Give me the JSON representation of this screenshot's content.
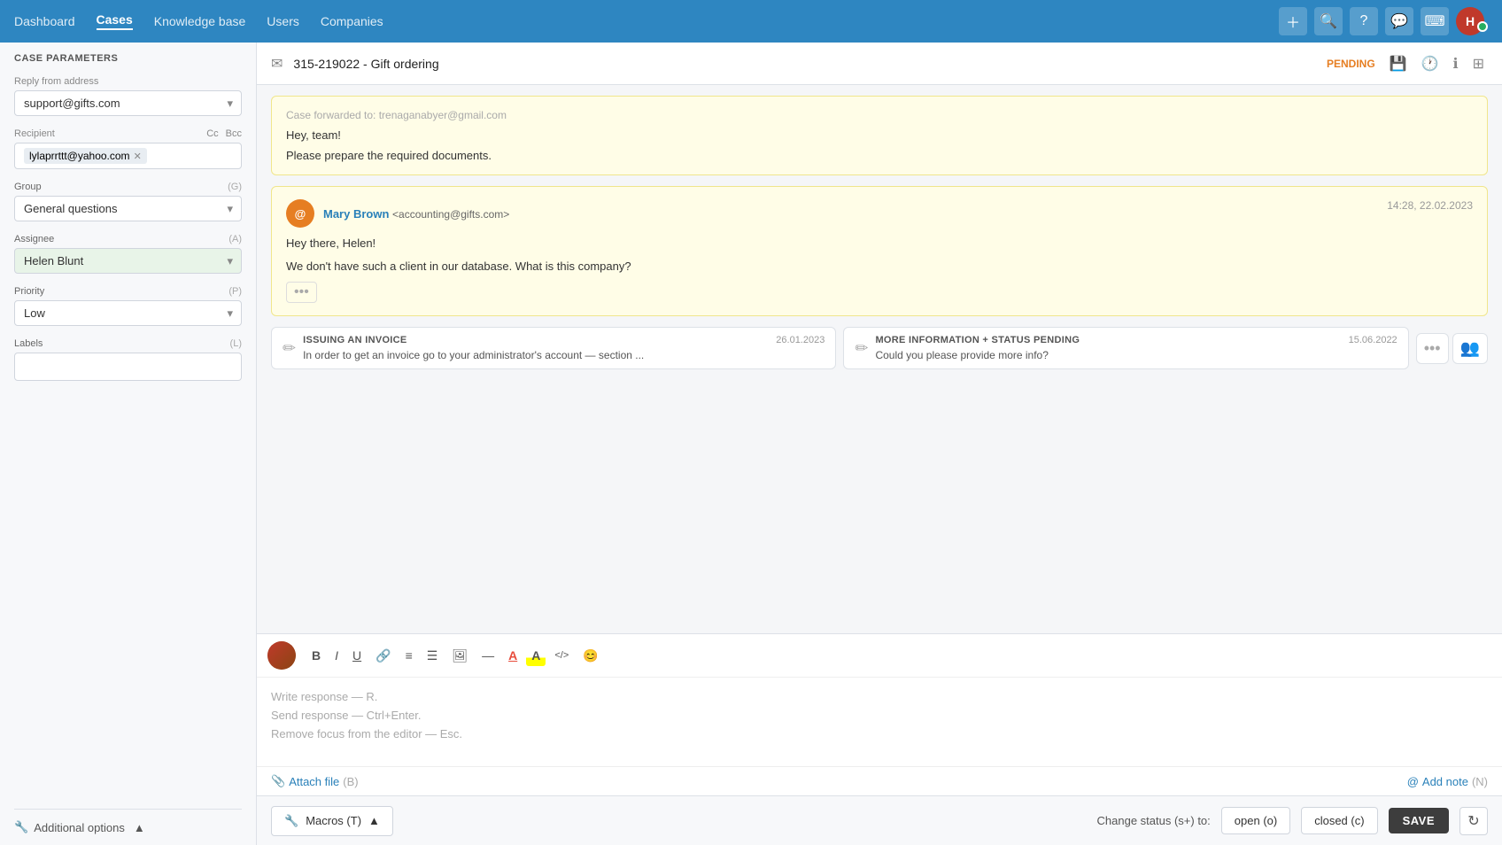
{
  "nav": {
    "items": [
      {
        "label": "Dashboard",
        "active": false
      },
      {
        "label": "Cases",
        "active": true
      },
      {
        "label": "Knowledge base",
        "active": false
      },
      {
        "label": "Users",
        "active": false
      },
      {
        "label": "Companies",
        "active": false
      }
    ],
    "icons": [
      "plus-icon",
      "search-icon",
      "help-icon",
      "chat-icon",
      "keyboard-icon"
    ]
  },
  "sidebar": {
    "title": "CASE PARAMETERS",
    "fields": {
      "reply_from": {
        "label": "Reply from address",
        "value": "support@gifts.com"
      },
      "recipient": {
        "label": "Recipient",
        "cc": "Cc",
        "bcc": "Bcc",
        "value": "lylaprrttt@yahoo.com"
      },
      "group": {
        "label": "Group",
        "shortcut": "(G)",
        "value": "General questions"
      },
      "assignee": {
        "label": "Assignee",
        "shortcut": "(A)",
        "value": "Helen Blunt"
      },
      "priority": {
        "label": "Priority",
        "shortcut": "(P)",
        "value": "Low"
      },
      "labels": {
        "label": "Labels",
        "shortcut": "(L)",
        "value": ""
      }
    },
    "additional_options": "Additional options"
  },
  "case_header": {
    "case_id": "315-219022",
    "subject": "Gift ordering",
    "full_title": "315-219022 - Gift ordering",
    "status": "PENDING"
  },
  "messages": [
    {
      "id": "msg1",
      "partial": true,
      "body_lines": [
        "Hey, team!",
        "Please prepare the required documents."
      ]
    },
    {
      "id": "msg2",
      "sender_name": "Mary Brown",
      "sender_email": "<accounting@gifts.com>",
      "time": "14:28, 22.02.2023",
      "avatar_text": "@",
      "body_lines": [
        "Hey there, Helen!",
        "We don't have such a client in our database. What is this company?"
      ]
    }
  ],
  "canned_responses": [
    {
      "title": "ISSUING AN INVOICE",
      "date": "26.01.2023",
      "body": "In order to get an invoice  go to your administrator's account — section ..."
    },
    {
      "title": "MORE INFORMATION + STATUS PENDING",
      "date": "15.06.2022",
      "body": "Could you please provide more info?"
    }
  ],
  "editor": {
    "placeholder_line1": "Write response — R.",
    "placeholder_line2": "Send response — Ctrl+Enter.",
    "placeholder_line3": "Remove focus from the editor — Esc.",
    "attach_file": "Attach file",
    "attach_shortcut": "(B)",
    "add_note": "Add note",
    "add_note_shortcut": "(N)"
  },
  "bottom_bar": {
    "macros_label": "Macros (T)",
    "change_status_label": "Change status (s+) to:",
    "open_btn": "open (o)",
    "closed_btn": "closed (c)",
    "save_btn": "SAVE"
  },
  "toolbar_buttons": [
    {
      "name": "bold",
      "symbol": "B",
      "bold": true
    },
    {
      "name": "italic",
      "symbol": "I",
      "italic": true
    },
    {
      "name": "underline",
      "symbol": "U",
      "underline": true
    },
    {
      "name": "link",
      "symbol": "🔗"
    },
    {
      "name": "align",
      "symbol": "≡"
    },
    {
      "name": "list",
      "symbol": "☰"
    },
    {
      "name": "image",
      "symbol": "🖼"
    },
    {
      "name": "hr",
      "symbol": "—"
    },
    {
      "name": "font-color",
      "symbol": "A"
    },
    {
      "name": "font-highlight",
      "symbol": "A"
    },
    {
      "name": "code",
      "symbol": "</>"
    },
    {
      "name": "emoji",
      "symbol": "😊"
    }
  ]
}
